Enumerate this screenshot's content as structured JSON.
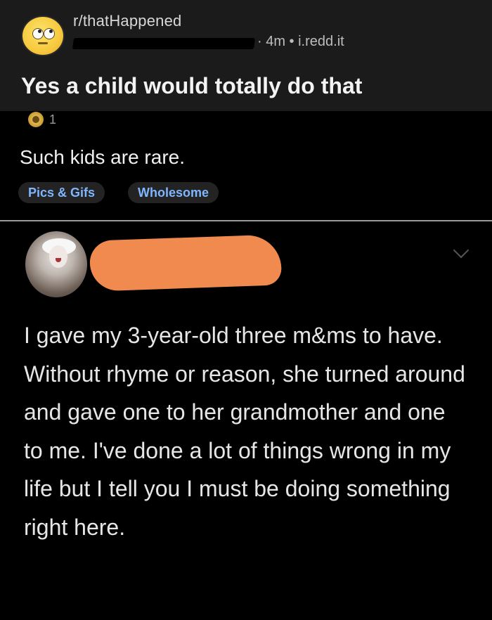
{
  "post": {
    "subreddit": "r/thatHappened",
    "meta": "· 4m • i.redd.it",
    "title": "Yes a child would totally do that",
    "award_count": "1",
    "body": "Such kids are rare.",
    "flairs": [
      "Pics & Gifs",
      "Wholesome"
    ]
  },
  "tweet": {
    "text": "I gave my 3-year-old three m&ms to have. Without rhyme or reason, she turned around and gave one to her grandmother and one to me. I've done a lot of things wrong in my life but I tell you I must be doing something right here."
  },
  "icons": {
    "subreddit_avatar": "rolling-eyes-emoji-icon",
    "award": "award-icon",
    "more": "chevron-down-icon"
  },
  "colors": {
    "background": "#000000",
    "header_band": "#1b1b1c",
    "flair_text": "#7fb6ff",
    "redaction_orange": "#f08a4e"
  }
}
